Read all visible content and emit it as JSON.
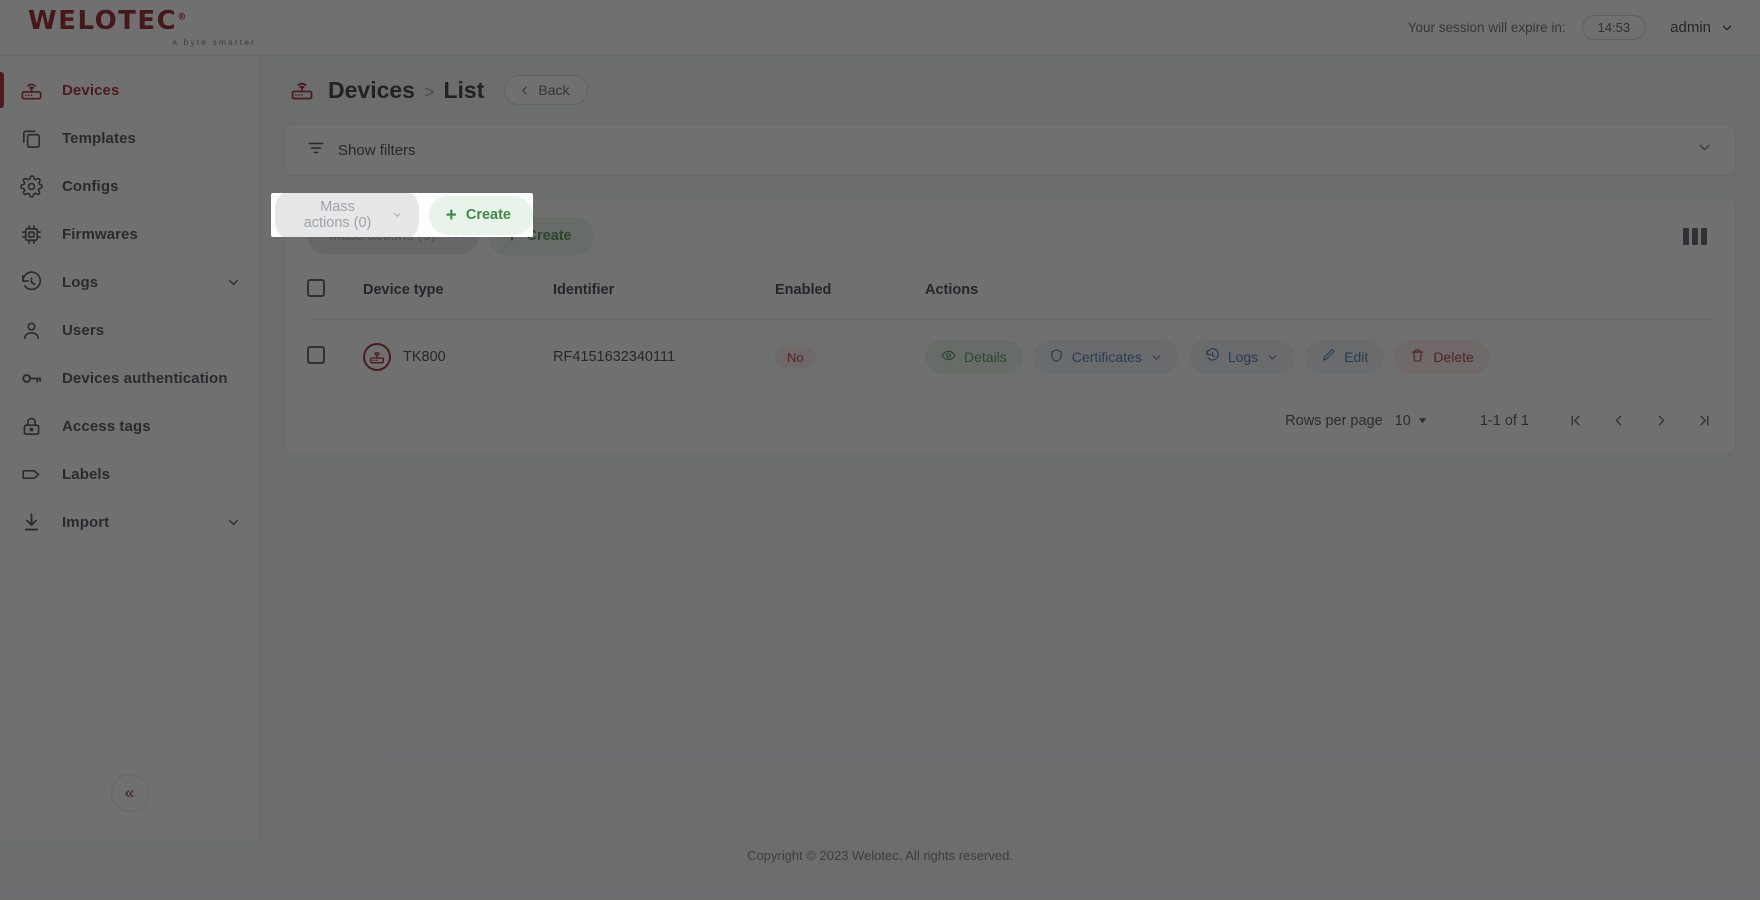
{
  "brand": {
    "name": "WELOTEC",
    "tm": "®",
    "tagline": "a byte smarter"
  },
  "topbar": {
    "session_label": "Your session will expire in:",
    "session_timer": "14:53",
    "user": "admin"
  },
  "sidebar": {
    "items": [
      {
        "label": "Devices",
        "icon": "router-icon",
        "active": true,
        "chevron": false
      },
      {
        "label": "Templates",
        "icon": "copy-icon",
        "active": false,
        "chevron": false
      },
      {
        "label": "Configs",
        "icon": "gear-icon",
        "active": false,
        "chevron": false
      },
      {
        "label": "Firmwares",
        "icon": "chip-icon",
        "active": false,
        "chevron": false
      },
      {
        "label": "Logs",
        "icon": "history-icon",
        "active": false,
        "chevron": true
      },
      {
        "label": "Users",
        "icon": "user-icon",
        "active": false,
        "chevron": false
      },
      {
        "label": "Devices authentication",
        "icon": "key-icon",
        "active": false,
        "chevron": false
      },
      {
        "label": "Access tags",
        "icon": "lock-icon",
        "active": false,
        "chevron": false
      },
      {
        "label": "Labels",
        "icon": "tag-icon",
        "active": false,
        "chevron": false
      },
      {
        "label": "Import",
        "icon": "download-icon",
        "active": false,
        "chevron": true
      }
    ],
    "collapse_label": "«"
  },
  "breadcrumb": {
    "root": "Devices",
    "separator": ">",
    "current": "List",
    "back_label": "Back"
  },
  "filters": {
    "label": "Show filters"
  },
  "toolbar": {
    "mass_actions_label": "Mass actions (0)",
    "create_label": "Create",
    "create_plus": "+"
  },
  "table": {
    "headers": [
      "Device type",
      "Identifier",
      "Enabled",
      "Actions"
    ],
    "rows": [
      {
        "device_type": "TK800",
        "identifier": "RF4151632340111",
        "enabled": "No",
        "actions": [
          {
            "label": "Details",
            "icon": "eye-icon",
            "style": "green",
            "chevron": false
          },
          {
            "label": "Certificates",
            "icon": "shield-icon",
            "style": "blue",
            "chevron": true
          },
          {
            "label": "Logs",
            "icon": "clock-icon",
            "style": "blue",
            "chevron": true
          },
          {
            "label": "Edit",
            "icon": "pencil-icon",
            "style": "blue",
            "chevron": false
          },
          {
            "label": "Delete",
            "icon": "trash-icon",
            "style": "red",
            "chevron": false
          }
        ]
      }
    ]
  },
  "pagination": {
    "rows_per_page_label": "Rows per page",
    "rows_per_page_value": "10",
    "range": "1-1 of 1",
    "first": "|<",
    "prev": "<",
    "next": ">",
    "last": ">|"
  },
  "footer": {
    "copyright": "Copyright © 2023 Welotec. All rights reserved."
  },
  "colors": {
    "brand": "#9b111e",
    "green": "#3f8a48",
    "blue": "#3b6fa8",
    "red": "#ab2b2b"
  }
}
